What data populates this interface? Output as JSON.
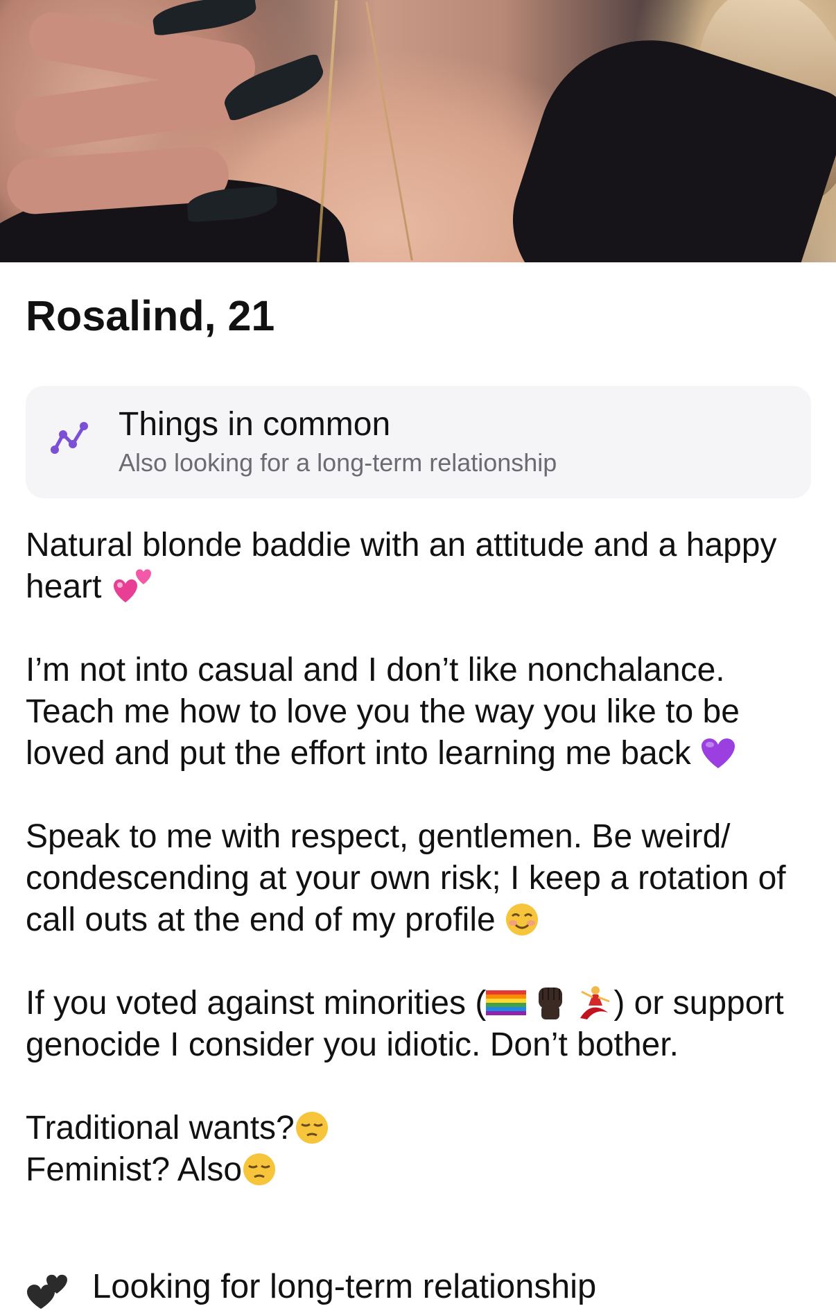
{
  "profile": {
    "name_age": "Rosalind, 21",
    "photo_icon": "profile-photo"
  },
  "things_in_common": {
    "icon": "connection-nodes-icon",
    "title": "Things in common",
    "subtitle": "Also looking for a long-term relationship",
    "accent_color": "#7b4fd6"
  },
  "bio": {
    "p1_text": "Natural blonde baddie with an attitude and a happy heart",
    "p1_emoji": "two-hearts-emoji",
    "p2_text": "I’m not into casual and I don’t like nonchalance. Teach me how to love you the way you like to be loved and put the effort into learning me back",
    "p2_emoji": "purple-heart-emoji",
    "p3_text": "Speak to me with respect, gentlemen. Be weird/ condescending at your own risk; I keep a rotation of call outs at the end of my profile",
    "p3_emoji": "smiling-face-emoji",
    "p4_before": "If you voted against minorities (",
    "p4_emojis": [
      "rainbow-flag-emoji",
      "raised-fist-emoji",
      "dancer-emoji"
    ],
    "p4_after": ") or support genocide I consider you idiotic. Don’t bother.",
    "p5_line1": "Traditional wants?",
    "p5_line2": "Feminist? Also",
    "p5_emoji": "pensive-face-emoji"
  },
  "looking_for": {
    "icon": "two-hearts-outline-icon",
    "label": "Looking for long-term relationship"
  }
}
